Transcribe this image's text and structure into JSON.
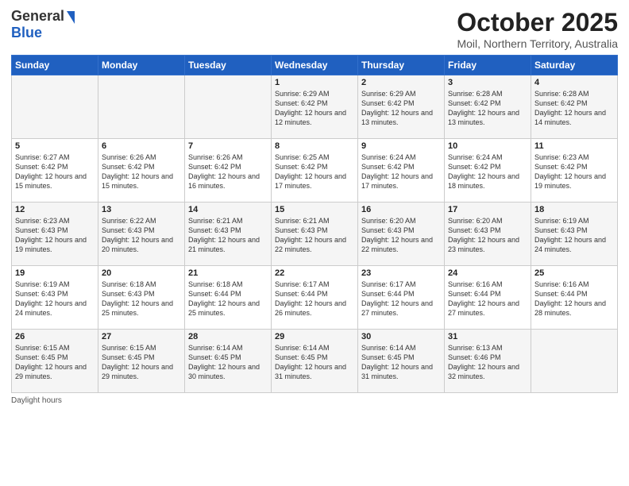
{
  "logo": {
    "general": "General",
    "blue": "Blue"
  },
  "header": {
    "month": "October 2025",
    "location": "Moil, Northern Territory, Australia"
  },
  "weekdays": [
    "Sunday",
    "Monday",
    "Tuesday",
    "Wednesday",
    "Thursday",
    "Friday",
    "Saturday"
  ],
  "footer": {
    "label": "Daylight hours"
  },
  "weeks": [
    [
      {
        "day": "",
        "sunrise": "",
        "sunset": "",
        "daylight": ""
      },
      {
        "day": "",
        "sunrise": "",
        "sunset": "",
        "daylight": ""
      },
      {
        "day": "",
        "sunrise": "",
        "sunset": "",
        "daylight": ""
      },
      {
        "day": "1",
        "sunrise": "Sunrise: 6:29 AM",
        "sunset": "Sunset: 6:42 PM",
        "daylight": "Daylight: 12 hours and 12 minutes."
      },
      {
        "day": "2",
        "sunrise": "Sunrise: 6:29 AM",
        "sunset": "Sunset: 6:42 PM",
        "daylight": "Daylight: 12 hours and 13 minutes."
      },
      {
        "day": "3",
        "sunrise": "Sunrise: 6:28 AM",
        "sunset": "Sunset: 6:42 PM",
        "daylight": "Daylight: 12 hours and 13 minutes."
      },
      {
        "day": "4",
        "sunrise": "Sunrise: 6:28 AM",
        "sunset": "Sunset: 6:42 PM",
        "daylight": "Daylight: 12 hours and 14 minutes."
      }
    ],
    [
      {
        "day": "5",
        "sunrise": "Sunrise: 6:27 AM",
        "sunset": "Sunset: 6:42 PM",
        "daylight": "Daylight: 12 hours and 15 minutes."
      },
      {
        "day": "6",
        "sunrise": "Sunrise: 6:26 AM",
        "sunset": "Sunset: 6:42 PM",
        "daylight": "Daylight: 12 hours and 15 minutes."
      },
      {
        "day": "7",
        "sunrise": "Sunrise: 6:26 AM",
        "sunset": "Sunset: 6:42 PM",
        "daylight": "Daylight: 12 hours and 16 minutes."
      },
      {
        "day": "8",
        "sunrise": "Sunrise: 6:25 AM",
        "sunset": "Sunset: 6:42 PM",
        "daylight": "Daylight: 12 hours and 17 minutes."
      },
      {
        "day": "9",
        "sunrise": "Sunrise: 6:24 AM",
        "sunset": "Sunset: 6:42 PM",
        "daylight": "Daylight: 12 hours and 17 minutes."
      },
      {
        "day": "10",
        "sunrise": "Sunrise: 6:24 AM",
        "sunset": "Sunset: 6:42 PM",
        "daylight": "Daylight: 12 hours and 18 minutes."
      },
      {
        "day": "11",
        "sunrise": "Sunrise: 6:23 AM",
        "sunset": "Sunset: 6:42 PM",
        "daylight": "Daylight: 12 hours and 19 minutes."
      }
    ],
    [
      {
        "day": "12",
        "sunrise": "Sunrise: 6:23 AM",
        "sunset": "Sunset: 6:43 PM",
        "daylight": "Daylight: 12 hours and 19 minutes."
      },
      {
        "day": "13",
        "sunrise": "Sunrise: 6:22 AM",
        "sunset": "Sunset: 6:43 PM",
        "daylight": "Daylight: 12 hours and 20 minutes."
      },
      {
        "day": "14",
        "sunrise": "Sunrise: 6:21 AM",
        "sunset": "Sunset: 6:43 PM",
        "daylight": "Daylight: 12 hours and 21 minutes."
      },
      {
        "day": "15",
        "sunrise": "Sunrise: 6:21 AM",
        "sunset": "Sunset: 6:43 PM",
        "daylight": "Daylight: 12 hours and 22 minutes."
      },
      {
        "day": "16",
        "sunrise": "Sunrise: 6:20 AM",
        "sunset": "Sunset: 6:43 PM",
        "daylight": "Daylight: 12 hours and 22 minutes."
      },
      {
        "day": "17",
        "sunrise": "Sunrise: 6:20 AM",
        "sunset": "Sunset: 6:43 PM",
        "daylight": "Daylight: 12 hours and 23 minutes."
      },
      {
        "day": "18",
        "sunrise": "Sunrise: 6:19 AM",
        "sunset": "Sunset: 6:43 PM",
        "daylight": "Daylight: 12 hours and 24 minutes."
      }
    ],
    [
      {
        "day": "19",
        "sunrise": "Sunrise: 6:19 AM",
        "sunset": "Sunset: 6:43 PM",
        "daylight": "Daylight: 12 hours and 24 minutes."
      },
      {
        "day": "20",
        "sunrise": "Sunrise: 6:18 AM",
        "sunset": "Sunset: 6:43 PM",
        "daylight": "Daylight: 12 hours and 25 minutes."
      },
      {
        "day": "21",
        "sunrise": "Sunrise: 6:18 AM",
        "sunset": "Sunset: 6:44 PM",
        "daylight": "Daylight: 12 hours and 25 minutes."
      },
      {
        "day": "22",
        "sunrise": "Sunrise: 6:17 AM",
        "sunset": "Sunset: 6:44 PM",
        "daylight": "Daylight: 12 hours and 26 minutes."
      },
      {
        "day": "23",
        "sunrise": "Sunrise: 6:17 AM",
        "sunset": "Sunset: 6:44 PM",
        "daylight": "Daylight: 12 hours and 27 minutes."
      },
      {
        "day": "24",
        "sunrise": "Sunrise: 6:16 AM",
        "sunset": "Sunset: 6:44 PM",
        "daylight": "Daylight: 12 hours and 27 minutes."
      },
      {
        "day": "25",
        "sunrise": "Sunrise: 6:16 AM",
        "sunset": "Sunset: 6:44 PM",
        "daylight": "Daylight: 12 hours and 28 minutes."
      }
    ],
    [
      {
        "day": "26",
        "sunrise": "Sunrise: 6:15 AM",
        "sunset": "Sunset: 6:45 PM",
        "daylight": "Daylight: 12 hours and 29 minutes."
      },
      {
        "day": "27",
        "sunrise": "Sunrise: 6:15 AM",
        "sunset": "Sunset: 6:45 PM",
        "daylight": "Daylight: 12 hours and 29 minutes."
      },
      {
        "day": "28",
        "sunrise": "Sunrise: 6:14 AM",
        "sunset": "Sunset: 6:45 PM",
        "daylight": "Daylight: 12 hours and 30 minutes."
      },
      {
        "day": "29",
        "sunrise": "Sunrise: 6:14 AM",
        "sunset": "Sunset: 6:45 PM",
        "daylight": "Daylight: 12 hours and 31 minutes."
      },
      {
        "day": "30",
        "sunrise": "Sunrise: 6:14 AM",
        "sunset": "Sunset: 6:45 PM",
        "daylight": "Daylight: 12 hours and 31 minutes."
      },
      {
        "day": "31",
        "sunrise": "Sunrise: 6:13 AM",
        "sunset": "Sunset: 6:46 PM",
        "daylight": "Daylight: 12 hours and 32 minutes."
      },
      {
        "day": "",
        "sunrise": "",
        "sunset": "",
        "daylight": ""
      }
    ]
  ]
}
